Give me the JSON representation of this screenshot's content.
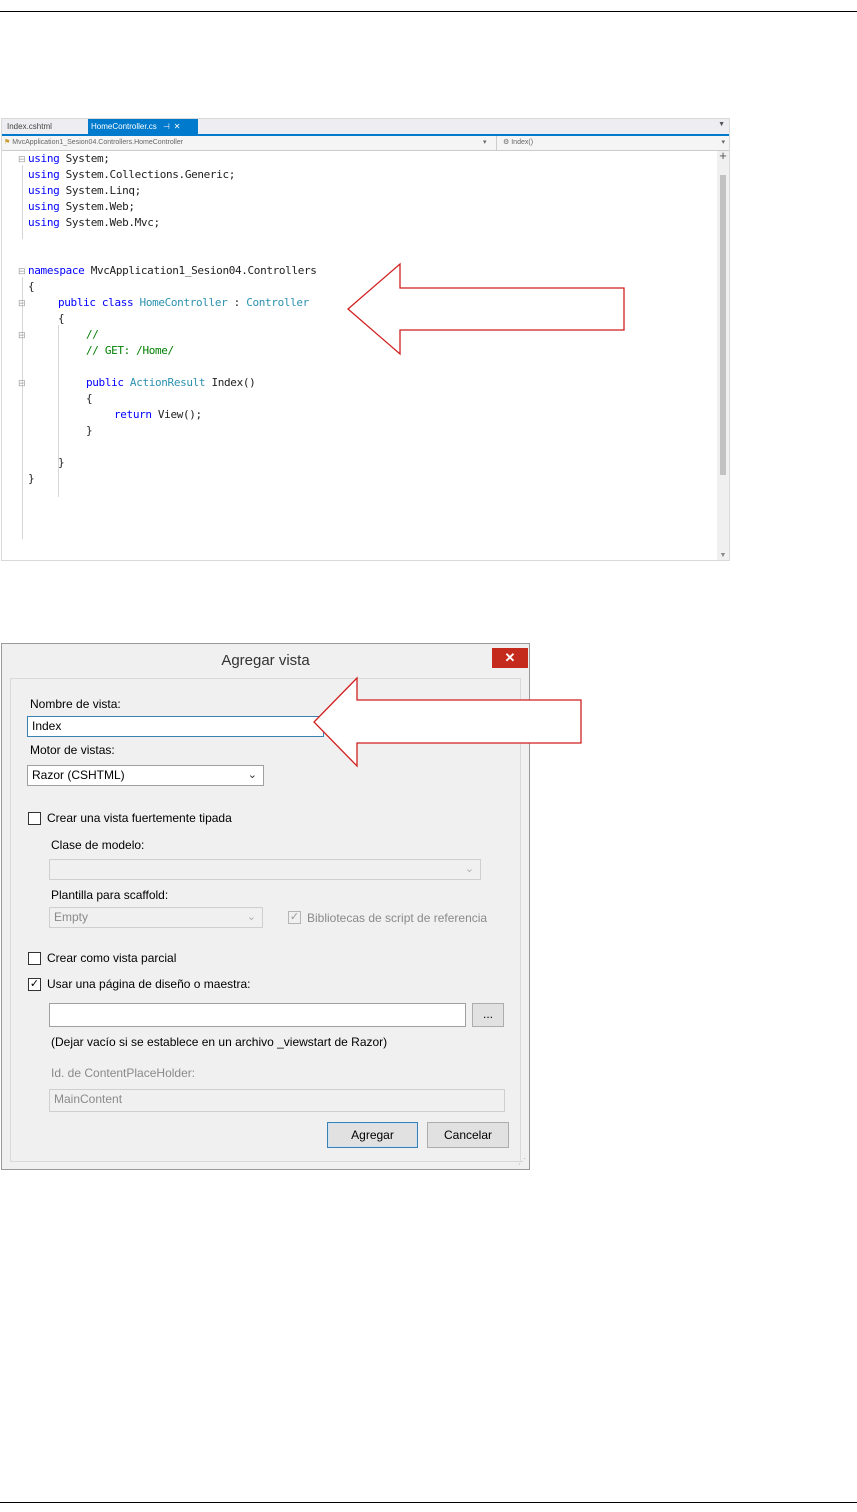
{
  "editor": {
    "tabs": [
      {
        "label": "Index.cshtml",
        "active": false
      },
      {
        "label": "HomeController.cs",
        "active": true,
        "pin": "⊣",
        "close": "✕"
      }
    ],
    "nav": {
      "class_path": "MvcApplication1_Sesion04.Controllers.HomeController",
      "member": "Index()"
    },
    "code": {
      "l1_kw": "using",
      "l1_rest": " System;",
      "l2_kw": "using",
      "l2_rest": " System.Collections.Generic;",
      "l3_kw": "using",
      "l3_rest": " System.Linq;",
      "l4_kw": "using",
      "l4_rest": " System.Web;",
      "l5_kw": "using",
      "l5_rest": " System.Web.Mvc;",
      "l7_kw": "namespace",
      "l7_rest": " MvcApplication1_Sesion04.Controllers",
      "l8": "{",
      "l9_kw": "public class ",
      "l9_type": "HomeController",
      "l9_sep": " : ",
      "l9_base": "Controller",
      "l10": "{",
      "l11": "//",
      "l12": "// GET: /Home/",
      "l14_kw": "public ",
      "l14_type": "ActionResult",
      "l14_rest": " Index()",
      "l15": "{",
      "l16_kw": "return",
      "l16_rest": " View();",
      "l17": "}",
      "l19": "}",
      "l20": "}"
    }
  },
  "dialog": {
    "title": "Agregar vista",
    "close": "✕",
    "view_name_label": "Nombre de vista:",
    "view_name_value": "Index",
    "engine_label": "Motor de vistas:",
    "engine_value": "Razor (CSHTML)",
    "strongly_typed_label": "Crear una vista fuertemente tipada",
    "strongly_typed_checked": false,
    "model_class_label": "Clase de modelo:",
    "model_class_value": "",
    "scaffold_label": "Plantilla para scaffold:",
    "scaffold_value": "Empty",
    "script_libs_label": "Bibliotecas de script de referencia",
    "script_libs_checked": true,
    "partial_label": "Crear como vista parcial",
    "partial_checked": false,
    "layout_label": "Usar una página de diseño o maestra:",
    "layout_checked": true,
    "layout_value": "",
    "browse_label": "...",
    "layout_hint": "(Dejar vacío si se establece en un archivo _viewstart de Razor)",
    "placeholder_label": "Id. de ContentPlaceHolder:",
    "placeholder_value": "MainContent",
    "add_button": "Agregar",
    "cancel_button": "Cancelar"
  },
  "colors": {
    "arrow_stroke": "#d11f1f",
    "keyword": "#0000ff",
    "type": "#2b91af",
    "comment": "#008000",
    "tab_active": "#007acc",
    "dialog_close": "#c42b1c"
  }
}
